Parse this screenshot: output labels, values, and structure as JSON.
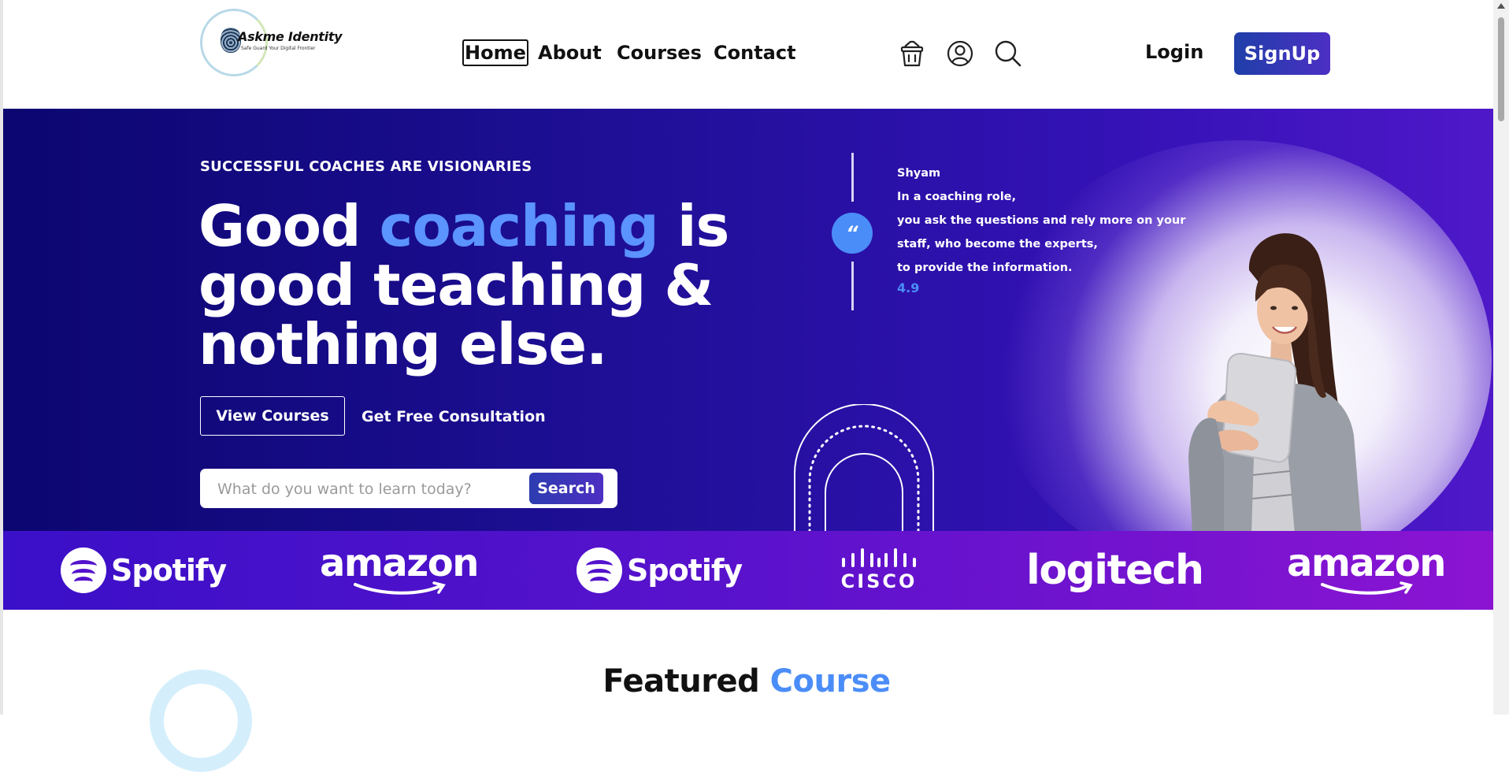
{
  "logo": {
    "name": "Askme Identity",
    "tagline": "Safe Guard Your Digital Frontier"
  },
  "nav": {
    "items": [
      {
        "label": "Home",
        "active": true
      },
      {
        "label": "About",
        "active": false
      },
      {
        "label": "Courses",
        "active": false
      },
      {
        "label": "Contact",
        "active": false
      }
    ]
  },
  "header": {
    "icons": [
      "cart-icon",
      "user-account-icon",
      "search-icon"
    ],
    "login_label": "Login",
    "signup_label": "SignUp"
  },
  "hero": {
    "eyebrow": "SUCCESSFUL COACHES ARE VISIONARIES",
    "headline": {
      "part1": "Good ",
      "accent": "coaching",
      "part2": " is",
      "line2": "good teaching &",
      "line3": "nothing else."
    },
    "view_courses_label": "View Courses",
    "consultation_label": "Get Free Consultation",
    "search": {
      "placeholder": "What do you want to learn today?",
      "button_label": "Search"
    },
    "testimonial": {
      "quote_mark": "“",
      "name": "Shyam",
      "lines": [
        "In a coaching role,",
        "you ask the questions and rely more on your",
        "staff, who become the experts,",
        "to provide the information."
      ],
      "rating": "4.9"
    }
  },
  "brands": [
    {
      "name": "Spotify",
      "icon": "spotify-icon"
    },
    {
      "name": "amazon"
    },
    {
      "name": "Spotify",
      "icon": "spotify-icon"
    },
    {
      "name": "CISCO",
      "icon": "cisco-icon"
    },
    {
      "name": "logitech"
    },
    {
      "name": "amazon"
    }
  ],
  "featured": {
    "title": "Featured ",
    "accent": "Course"
  },
  "colors": {
    "accent_blue": "#4b8df8",
    "brand_primary": "#2b3db5",
    "hero_dark": "#0b0670",
    "hero_purple": "#4f18c9"
  }
}
